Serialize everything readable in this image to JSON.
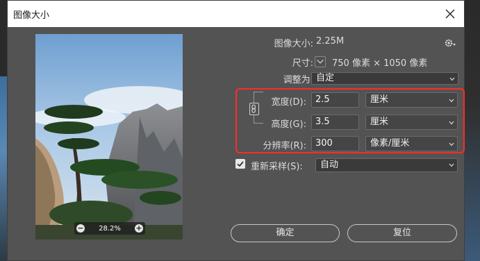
{
  "window": {
    "title": "图像大小"
  },
  "preview": {
    "zoom_level": "28.2%",
    "zoom_out_symbol": "−",
    "zoom_in_symbol": "+"
  },
  "info": {
    "image_size_label": "图像大小:",
    "image_size_value": "2.25M",
    "dimensions_label": "尺寸:",
    "dimensions_value": "750 像素 × 1050 像素"
  },
  "fit_to": {
    "label": "调整为:",
    "value": "自定"
  },
  "width": {
    "label": "宽度(D):",
    "value": "2.5",
    "unit": "厘米"
  },
  "height": {
    "label": "高度(G):",
    "value": "3.5",
    "unit": "厘米"
  },
  "resolution": {
    "label": "分辨率(R):",
    "value": "300",
    "unit": "像素/厘米"
  },
  "resample": {
    "checked": true,
    "label": "重新采样(S):",
    "value": "自动"
  },
  "buttons": {
    "ok": "确定",
    "reset": "复位"
  },
  "colors": {
    "highlight": "#ff2a2a",
    "dialog_bg": "#535353"
  },
  "icons": [
    "close-icon",
    "gear-icon",
    "chevron-down-icon",
    "link-icon",
    "zoom-out-icon",
    "zoom-in-icon",
    "checkmark-icon"
  ]
}
